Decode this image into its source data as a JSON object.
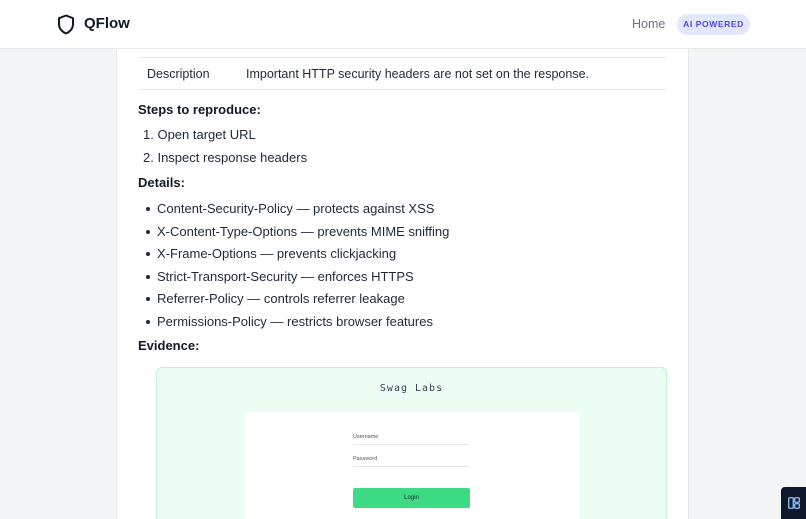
{
  "header": {
    "brand": "QFlow",
    "nav_home": "Home",
    "badge": "AI POWERED",
    "logo_icon": "shield-icon"
  },
  "details_table": {
    "description_key": "Description",
    "description_value": "Important HTTP security headers are not set on the response."
  },
  "steps": {
    "heading": "Steps to reproduce:",
    "items": [
      "Open target URL",
      "Inspect response headers"
    ]
  },
  "details": {
    "heading": "Details:",
    "items": [
      "Content-Security-Policy — protects against XSS",
      "X-Content-Type-Options — prevents MIME sniffing",
      "X-Frame-Options — prevents clickjacking",
      "Strict-Transport-Security — enforces HTTPS",
      "Referrer-Policy — controls referrer leakage",
      "Permissions-Policy — restricts browser features"
    ]
  },
  "evidence": {
    "heading": "Evidence:",
    "screenshot": {
      "title": "Swag Labs",
      "username_label": "Username",
      "password_label": "Password",
      "login_label": "Login"
    }
  },
  "colors": {
    "accent": "#4f46e5",
    "badge_bg": "#e0e7ff",
    "evidence_bg": "#ecfdf3",
    "login_button": "#3ddc84"
  },
  "corner_icon": "layout-grid-icon"
}
